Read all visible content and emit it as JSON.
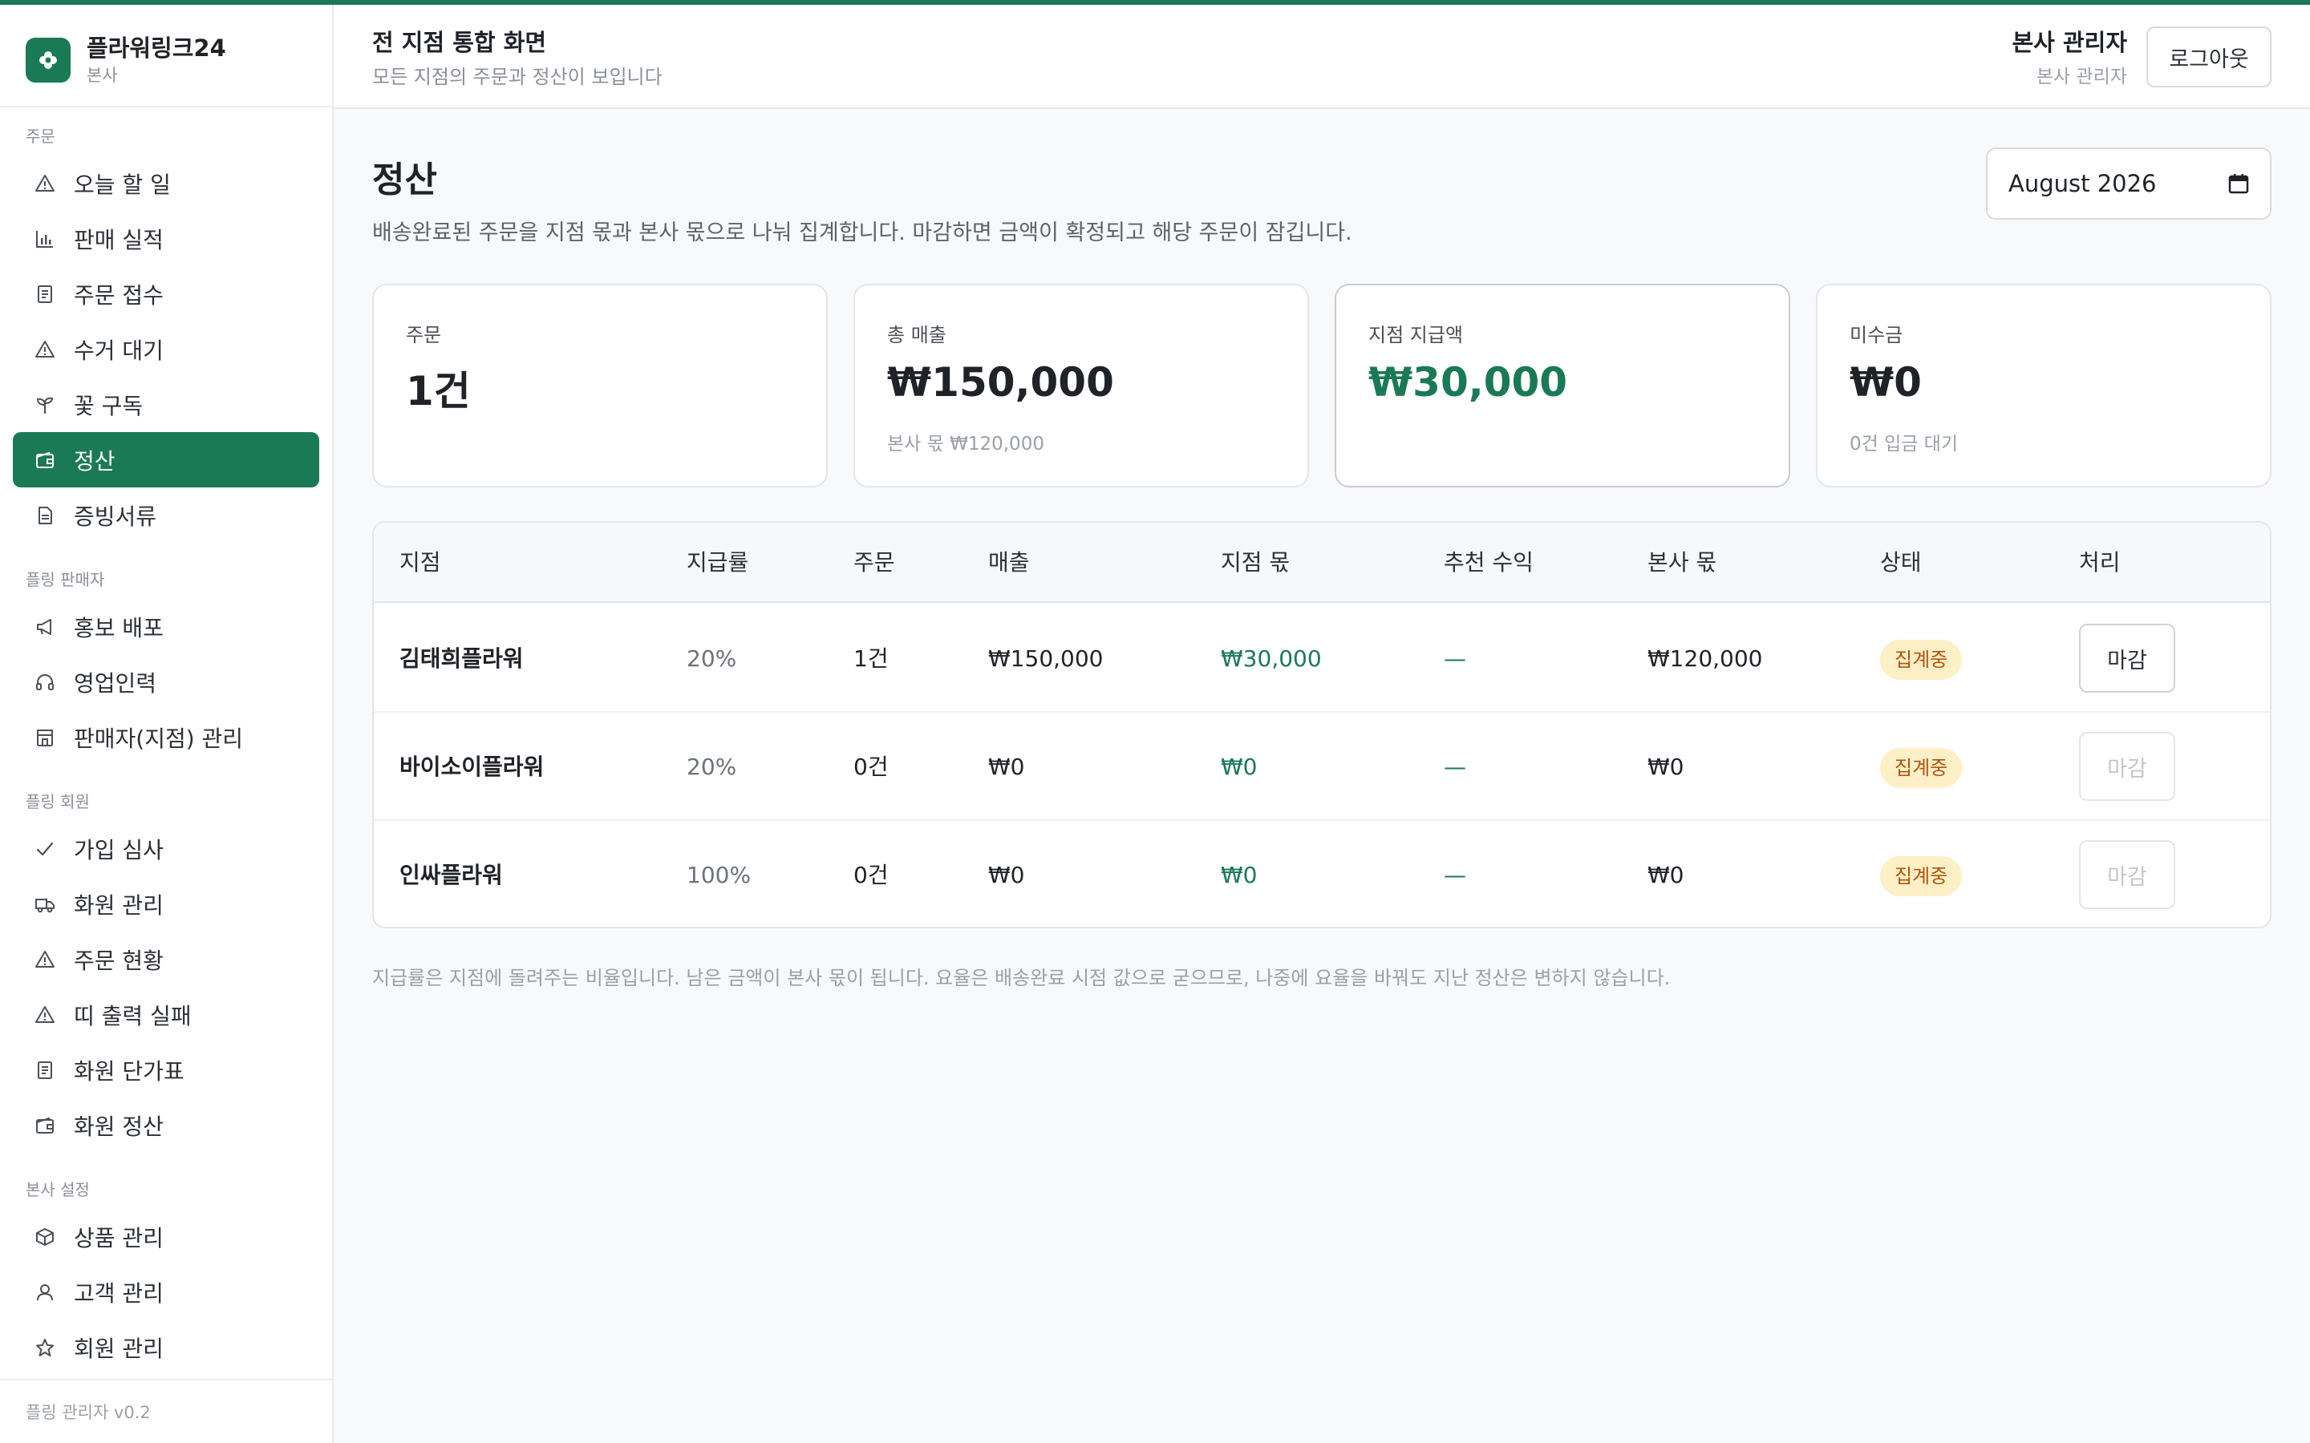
{
  "brand": {
    "name": "플라워링크24",
    "sub": "본사"
  },
  "header": {
    "title": "전 지점 통합 화면",
    "subtitle": "모든 지점의 주문과 정산이 보입니다",
    "user_name": "본사 관리자",
    "user_role": "본사 관리자",
    "logout_label": "로그아웃"
  },
  "sidebar": {
    "sections": [
      {
        "title": "주문",
        "items": [
          {
            "label": "오늘 할 일",
            "icon": "warning-icon"
          },
          {
            "label": "판매 실적",
            "icon": "bar-chart-icon"
          },
          {
            "label": "주문 접수",
            "icon": "receipt-icon"
          },
          {
            "label": "수거 대기",
            "icon": "warning-icon"
          },
          {
            "label": "꽃 구독",
            "icon": "sprout-icon"
          },
          {
            "label": "정산",
            "icon": "wallet-icon",
            "active": true
          },
          {
            "label": "증빙서류",
            "icon": "document-icon"
          }
        ]
      },
      {
        "title": "플링 판매자",
        "items": [
          {
            "label": "홍보 배포",
            "icon": "megaphone-icon"
          },
          {
            "label": "영업인력",
            "icon": "headset-icon"
          },
          {
            "label": "판매자(지점) 관리",
            "icon": "store-icon"
          }
        ]
      },
      {
        "title": "플링 회원",
        "items": [
          {
            "label": "가입 심사",
            "icon": "check-icon"
          },
          {
            "label": "화원 관리",
            "icon": "truck-icon"
          },
          {
            "label": "주문 현황",
            "icon": "warning-icon"
          },
          {
            "label": "띠 출력 실패",
            "icon": "warning-icon"
          },
          {
            "label": "화원 단가표",
            "icon": "receipt-icon"
          },
          {
            "label": "화원 정산",
            "icon": "wallet-icon"
          }
        ]
      },
      {
        "title": "본사 설정",
        "items": [
          {
            "label": "상품 관리",
            "icon": "box-icon"
          },
          {
            "label": "고객 관리",
            "icon": "user-icon"
          },
          {
            "label": "회원 관리",
            "icon": "star-icon"
          }
        ]
      }
    ],
    "footer": "플링 관리자 v0.2"
  },
  "page": {
    "title": "정산",
    "description": "배송완료된 주문을 지점 몫과 본사 몫으로 나눠 집계합니다. 마감하면 금액이 확정되고 해당 주문이 잠깁니다.",
    "month": "August 2026"
  },
  "cards": [
    {
      "label": "주문",
      "value": "1건",
      "sub": ""
    },
    {
      "label": "총 매출",
      "value": "₩150,000",
      "sub": "본사 몫 ₩120,000"
    },
    {
      "label": "지점 지급액",
      "value": "₩30,000",
      "sub": ""
    },
    {
      "label": "미수금",
      "value": "₩0",
      "sub": "0건 입금 대기"
    }
  ],
  "table": {
    "headers": [
      "지점",
      "지급률",
      "주문",
      "매출",
      "지점 몫",
      "추천 수익",
      "본사 몫",
      "상태",
      "처리"
    ],
    "rows": [
      {
        "branch": "김태희플라워",
        "rate": "20%",
        "orders": "1건",
        "sales": "₩150,000",
        "branch_share": "₩30,000",
        "referral": "—",
        "hq_share": "₩120,000",
        "status": "집계중",
        "action": "마감",
        "action_enabled": true
      },
      {
        "branch": "바이소이플라워",
        "rate": "20%",
        "orders": "0건",
        "sales": "₩0",
        "branch_share": "₩0",
        "referral": "—",
        "hq_share": "₩0",
        "status": "집계중",
        "action": "마감",
        "action_enabled": false
      },
      {
        "branch": "인싸플라워",
        "rate": "100%",
        "orders": "0건",
        "sales": "₩0",
        "branch_share": "₩0",
        "referral": "—",
        "hq_share": "₩0",
        "status": "집계중",
        "action": "마감",
        "action_enabled": false
      }
    ]
  },
  "footnote": "지급률은 지점에 돌려주는 비율입니다. 남은 금액이 본사 몫이 됩니다. 요율은 배송완료 시점 값으로 굳으므로, 나중에 요율을 바꿔도 지난 정산은 변하지 않습니다.",
  "colors": {
    "accent": "#1a7a55",
    "badge_bg": "#fdf0c7",
    "badge_text": "#b4530c"
  }
}
